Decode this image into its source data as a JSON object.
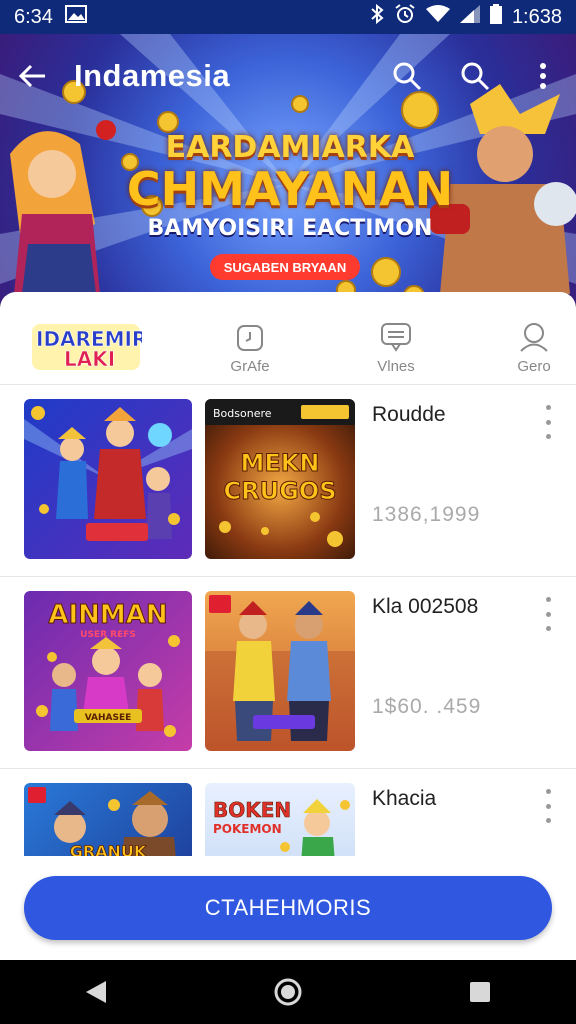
{
  "status_bar": {
    "time": "6:34",
    "clock_right": "1:638",
    "icons": [
      "image-icon",
      "bluetooth-icon",
      "alarm-icon",
      "wifi-icon",
      "signal-icon",
      "battery-icon"
    ]
  },
  "app_bar": {
    "title": "Indamesia",
    "back_icon": "arrow-left-icon",
    "actions": [
      "search-icon",
      "search-icon",
      "more-vert-icon"
    ]
  },
  "hero": {
    "line1": "EARDAMIARKA",
    "line2": "CHMAYANAN",
    "line3": "BAMYOISIRI EACTIMON",
    "pill": "SUGABEN BRYAAN",
    "colors": {
      "title": "#ffc21a",
      "pill": "#ff3b30"
    }
  },
  "tabs": {
    "logo_line1": "IDAREMIR",
    "logo_line2": "LAKI",
    "items": [
      {
        "icon": "clock-badge-icon",
        "label": "GrAfe"
      },
      {
        "icon": "chat-icon",
        "label": "Vlnes"
      },
      {
        "icon": "profile-icon",
        "label": "Gero"
      }
    ]
  },
  "rows": [
    {
      "name": "Roudde",
      "number": "1386,1999",
      "thumb_b_top": "Bodsonere",
      "thumb_b_title1": "MEKN",
      "thumb_b_title2": "CRUGOS",
      "thumb_a_banner": ""
    },
    {
      "name": "Kla 002508",
      "number": "1$60. .459",
      "thumb_a_title": "AINMAN",
      "thumb_a_sub": "USER REFS",
      "thumb_a_banner": "VAHASEE",
      "thumb_b_banner": ""
    },
    {
      "name": "Khacia",
      "number": "",
      "thumb_a_title": "GRANUK",
      "thumb_b_title1": "BOKEN",
      "thumb_b_title2": "POKEMON"
    }
  ],
  "cta": {
    "label": "CTAHEHMORIS",
    "color": "#2f57e0"
  },
  "nav_bar": {
    "icons": [
      "back-triangle-icon",
      "home-circle-icon",
      "recents-square-icon"
    ]
  }
}
